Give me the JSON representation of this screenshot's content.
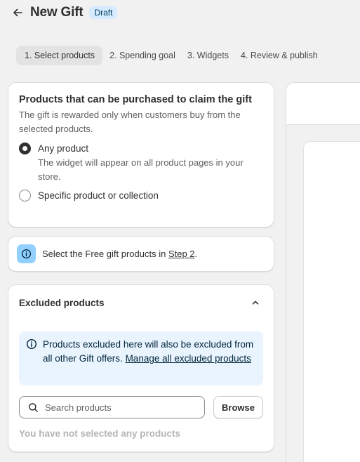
{
  "header": {
    "back_icon": "arrow-left-icon",
    "title": "New Gift",
    "badge": "Draft"
  },
  "steps": [
    {
      "label": "1. Select products",
      "active": true
    },
    {
      "label": "2. Spending goal",
      "active": false
    },
    {
      "label": "3. Widgets",
      "active": false
    },
    {
      "label": "4. Review & publish",
      "active": false
    }
  ],
  "products_card": {
    "title": "Products that can be purchased to claim the gift",
    "description": "The gift is rewarded only when customers buy from the selected products.",
    "options": [
      {
        "label": "Any product",
        "checked": true,
        "help": "The widget will appear on all product pages in your store."
      },
      {
        "label": "Specific product or collection",
        "checked": false
      }
    ]
  },
  "notice": {
    "icon": "info-icon",
    "text_before": "Select the Free gift products in ",
    "link": "Step 2",
    "text_after": "."
  },
  "excluded": {
    "title": "Excluded products",
    "toggle_icon": "chevron-up-icon",
    "banner_icon": "info-circle-icon",
    "banner_text": "Products excluded here will also be excluded from all other Gift offers. ",
    "banner_link": "Manage all excluded products",
    "search_placeholder": "Search products",
    "search_value": "",
    "browse_label": "Browse",
    "empty_text": "You have not selected any products"
  },
  "colors": {
    "badge_bg": "#d5ebff",
    "info_bg": "#91d0ff",
    "banner_bg": "#eaf4ff",
    "page_bg": "#f1f1f1"
  }
}
